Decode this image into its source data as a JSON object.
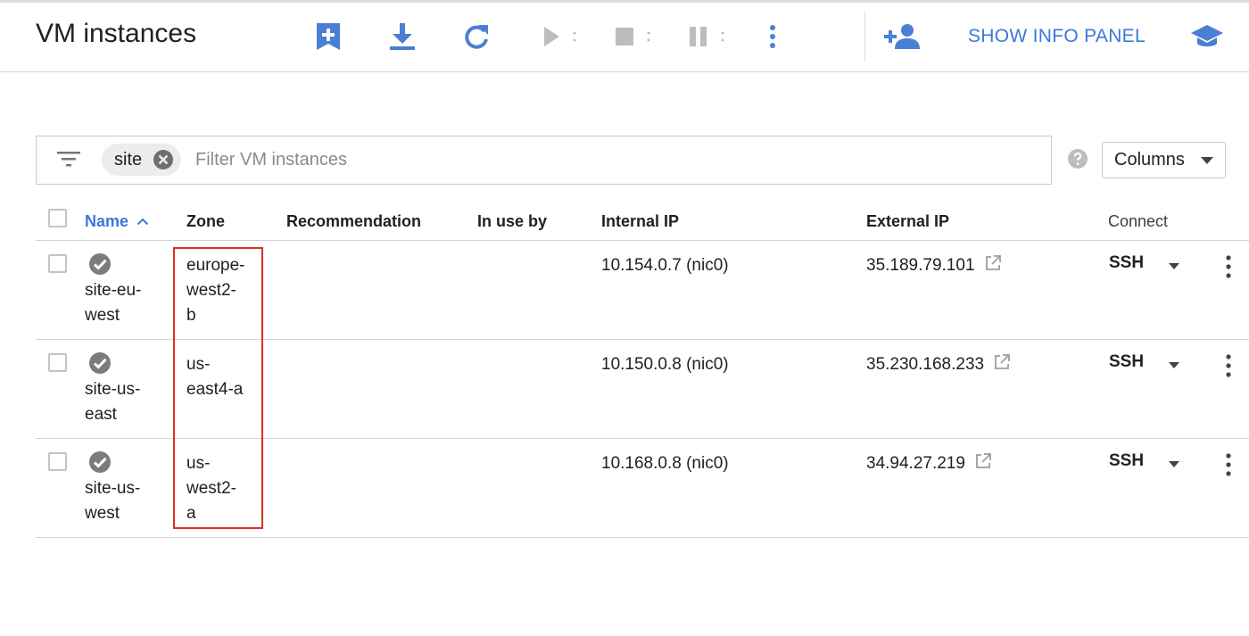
{
  "header": {
    "title": "VM instances",
    "info_panel_label": "SHOW INFO PANEL"
  },
  "filter": {
    "chip_label": "site",
    "placeholder": "Filter VM instances"
  },
  "columns_button": {
    "label": "Columns"
  },
  "table": {
    "headers": {
      "name": "Name",
      "zone": "Zone",
      "recommendation": "Recommendation",
      "in_use_by": "In use by",
      "internal_ip": "Internal IP",
      "external_ip": "External IP",
      "connect": "Connect"
    },
    "rows": [
      {
        "name_lines": [
          "site-eu-",
          "west"
        ],
        "zone_lines": [
          "europe-",
          "west2-",
          "b"
        ],
        "internal_ip": "10.154.0.7 (nic0)",
        "external_ip": "35.189.79.101",
        "connect": "SSH"
      },
      {
        "name_lines": [
          "site-us-",
          "east"
        ],
        "zone_lines": [
          "us-",
          "east4-a"
        ],
        "internal_ip": "10.150.0.8 (nic0)",
        "external_ip": "35.230.168.233",
        "connect": "SSH"
      },
      {
        "name_lines": [
          "site-us-",
          "west"
        ],
        "zone_lines": [
          "us-",
          "west2-",
          "a"
        ],
        "internal_ip": "10.168.0.8 (nic0)",
        "external_ip": "34.94.27.219",
        "connect": "SSH"
      }
    ]
  },
  "icons": {
    "toolbar": [
      "create-instance-icon",
      "import-vm-icon",
      "refresh-icon",
      "start-icon",
      "stop-icon",
      "suspend-icon",
      "more-actions-icon"
    ],
    "header_right": [
      "add-member-icon",
      "learn-icon"
    ],
    "row_status": "running-check-icon",
    "external_link": "open-in-new-icon"
  },
  "colors": {
    "accent": "#3c78d8",
    "toolbar_icon": "#4a7fd4",
    "disabled_icon": "#bdbdbd",
    "status_ok": "#7c7c7c",
    "highlight": "#d93025"
  }
}
